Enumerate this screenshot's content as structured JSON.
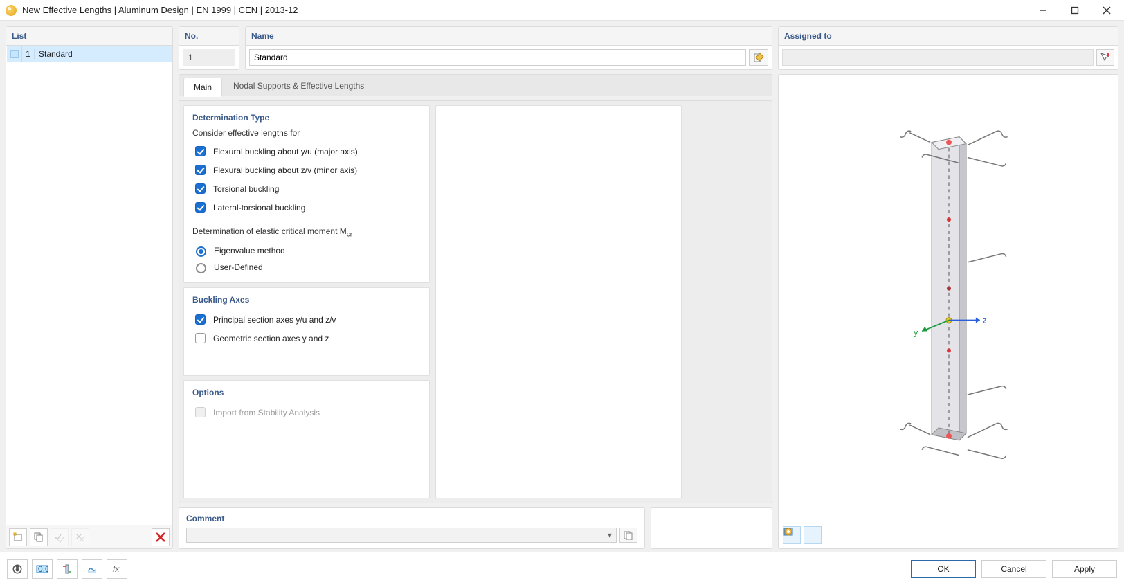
{
  "window": {
    "title": "New Effective Lengths | Aluminum Design | EN 1999 | CEN | 2013-12"
  },
  "list": {
    "header": "List",
    "rows": [
      {
        "no": "1",
        "name": "Standard"
      }
    ],
    "toolbar": {
      "new": "New",
      "copy": "Copy",
      "check_all": "Check All",
      "uncheck_all": "Uncheck All",
      "delete": "Delete"
    }
  },
  "header": {
    "no_label": "No.",
    "no_value": "1",
    "name_label": "Name",
    "name_value": "Standard",
    "edit": "Edit Name"
  },
  "assigned": {
    "label": "Assigned to",
    "value": "",
    "pick": "Select"
  },
  "tabs": {
    "main": "Main",
    "nodal": "Nodal Supports & Effective Lengths"
  },
  "determination": {
    "title": "Determination Type",
    "consider_label": "Consider effective lengths for",
    "flex_yu": "Flexural buckling about y/u (major axis)",
    "flex_zv": "Flexural buckling about z/v (minor axis)",
    "torsional": "Torsional buckling",
    "lateral": "Lateral-torsional buckling",
    "mcr_label": "Determination of elastic critical moment M",
    "mcr_sub": "cr",
    "eigen": "Eigenvalue method",
    "user": "User-Defined"
  },
  "buckling_axes": {
    "title": "Buckling Axes",
    "principal": "Principal section axes y/u and z/v",
    "geometric": "Geometric section axes y and z"
  },
  "options": {
    "title": "Options",
    "import": "Import from Stability Analysis"
  },
  "comment": {
    "title": "Comment",
    "value": ""
  },
  "preview": {
    "axes": {
      "y": "y",
      "z": "z"
    }
  },
  "footer": {
    "ok": "OK",
    "cancel": "Cancel",
    "apply": "Apply",
    "tools": {
      "help": "Help",
      "units": "Units",
      "member": "Member",
      "render": "Render",
      "fx": "Function"
    }
  }
}
